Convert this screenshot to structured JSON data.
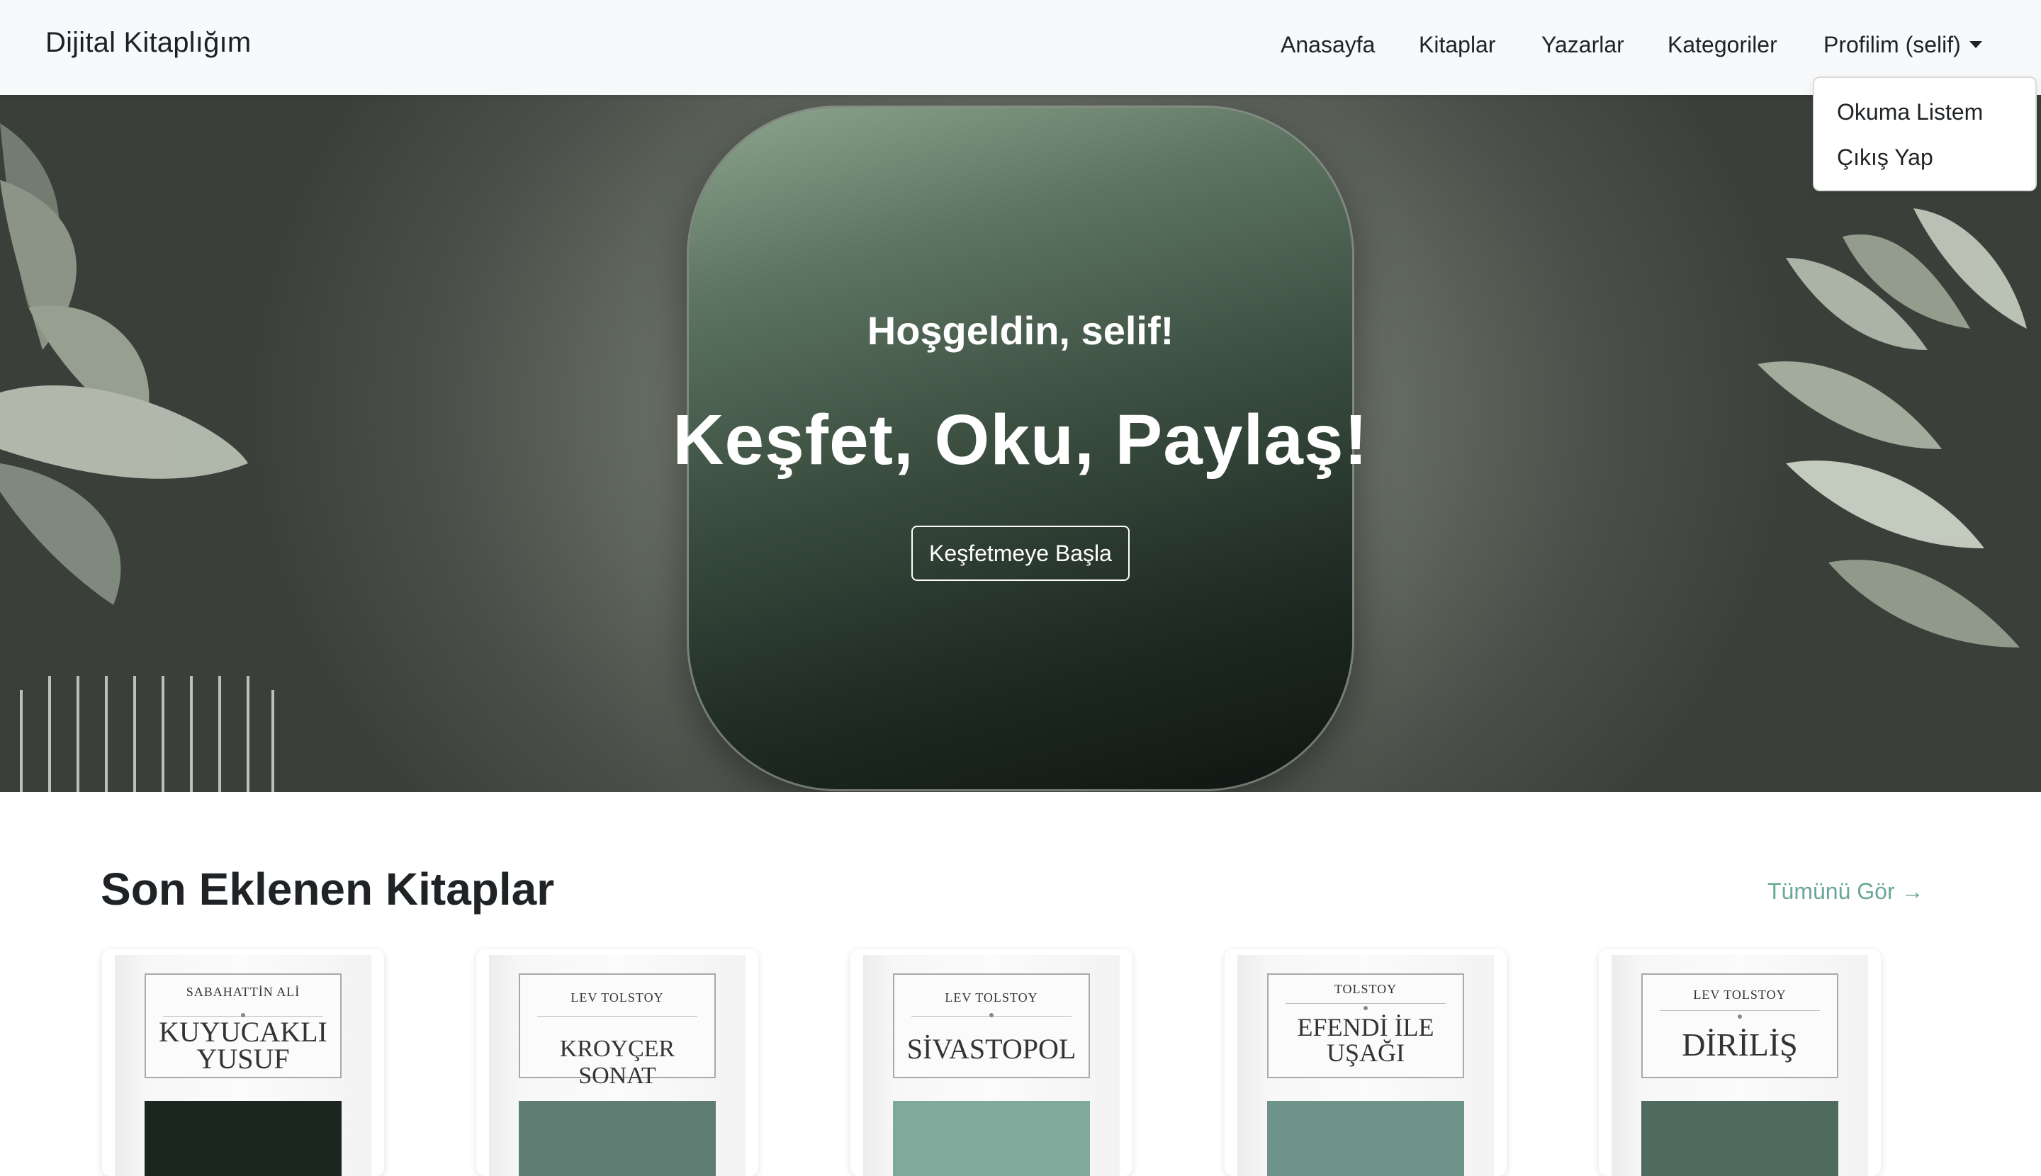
{
  "navbar": {
    "brand": "Dijital Kitaplığım",
    "links": [
      {
        "label": "Anasayfa"
      },
      {
        "label": "Kitaplar"
      },
      {
        "label": "Yazarlar"
      },
      {
        "label": "Kategoriler"
      }
    ],
    "profile_label": "Profilim (selif)"
  },
  "dropdown": {
    "items": [
      {
        "label": "Okuma Listem"
      },
      {
        "label": "Çıkış Yap"
      }
    ]
  },
  "hero": {
    "greeting": "Hoşgeldin, selif!",
    "title": "Keşfet, Oku, Paylaş!",
    "button_label": "Keşfetmeye Başla"
  },
  "recent": {
    "title": "Son Eklenen Kitaplar",
    "see_all_label": "Tümünü Gör →",
    "books": [
      {
        "author": "SABAHATTİN ALİ",
        "title": "KUYUCAKLI YUSUF",
        "cover_color": "#1c2620"
      },
      {
        "author": "LEV TOLSTOY",
        "title": "KROYÇER SONAT",
        "cover_color": "#5f7d72"
      },
      {
        "author": "LEV TOLSTOY",
        "title": "SİVASTOPOL",
        "cover_color": "#7fa99b"
      },
      {
        "author": "TOLSTOY",
        "title": "EFENDİ İLE UŞAĞI",
        "cover_color": "#6e948a"
      },
      {
        "author": "LEV TOLSTOY",
        "title": "DİRİLİŞ",
        "cover_color": "#4f6b60"
      }
    ]
  },
  "colors": {
    "navbar_bg": "#f8f9fa",
    "link_accent": "#6aa799"
  }
}
